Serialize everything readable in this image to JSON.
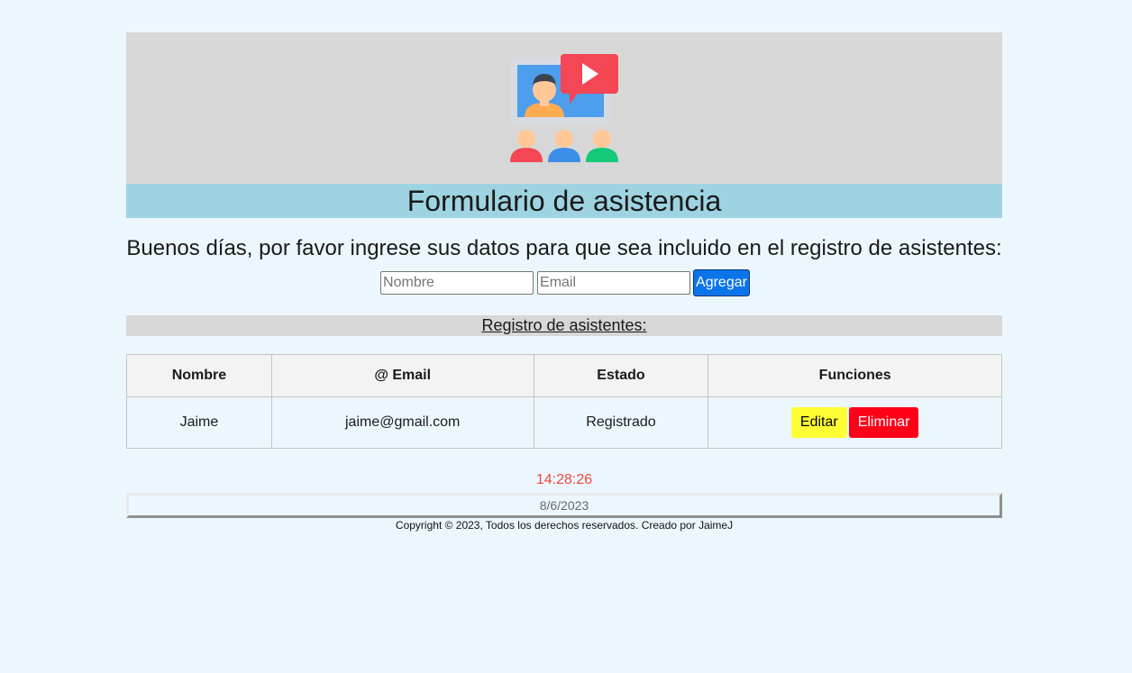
{
  "header": {
    "icon": "video-conference-icon",
    "title": "Formulario de asistencia"
  },
  "form": {
    "greeting": "Buenos días, por favor ingrese sus datos para que sea incluido en el registro de asistentes:",
    "name_placeholder": "Nombre",
    "name_value": "",
    "email_placeholder": "Email",
    "email_value": "",
    "add_label": "Agregar"
  },
  "registry": {
    "title": "Registro de asistentes:",
    "columns": [
      "Nombre",
      "@ Email",
      "Estado",
      "Funciones"
    ],
    "rows": [
      {
        "name": "Jaime",
        "email": "jaime@gmail.com",
        "status": "Registrado",
        "edit_label": "Editar",
        "delete_label": "Eliminar"
      }
    ]
  },
  "footer": {
    "clock": "14:28:26",
    "date": "8/6/2023",
    "copyright": "Copyright © 2023, Todos los derechos reservados. Creado por JaimeJ"
  },
  "colors": {
    "page_bg": "#ecf7fd",
    "title_bar": "#9ed4e2",
    "add_button": "#0a74ea",
    "edit_button": "#ffff33",
    "delete_button": "#ff0019",
    "clock_text": "#f2463d"
  }
}
